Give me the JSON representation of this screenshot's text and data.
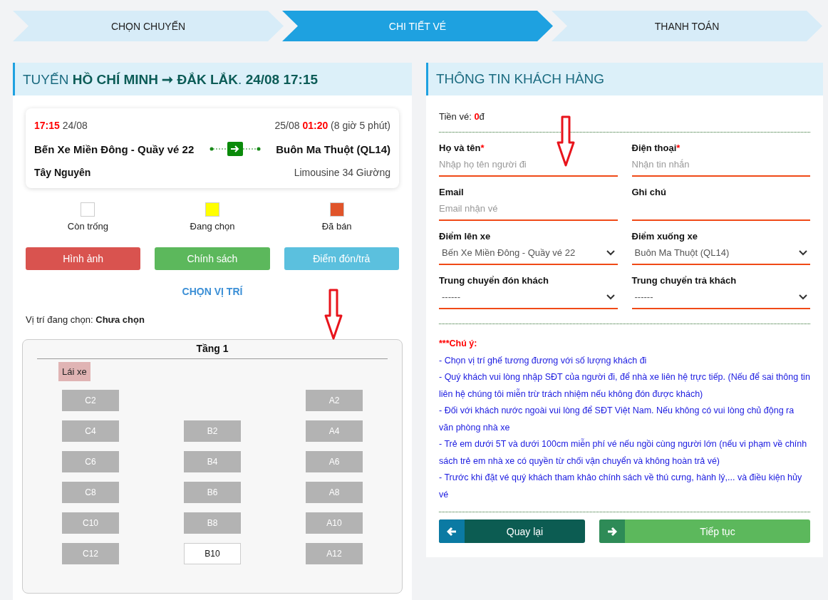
{
  "steps": [
    {
      "label": "CHỌN CHUYẾN",
      "selected": false
    },
    {
      "label": "CHI TIẾT VÉ",
      "selected": true
    },
    {
      "label": "THANH TOÁN",
      "selected": false
    }
  ],
  "route": {
    "title": "TUYẾN **HỒ CHÍ MINH ➞ ĐẮK LẮK**. **24/08 17:15**",
    "trip": {
      "depart": "**17:15** 24/08",
      "arrive": "25/08 **01:20** (8 giờ 5 phút)",
      "from": "Bến Xe Miền Đông - Quầy vé 22",
      "to": "Buôn Ma Thuột (QL14)",
      "operator": "Tây Nguyên",
      "vehicle": "Limousine 34 Giường"
    },
    "legend": [
      {
        "label": "Còn trống",
        "color": "#ffffff"
      },
      {
        "label": "Đang chọn",
        "color": "#ffff00"
      },
      {
        "label": "Đã bán",
        "color": "#e0542a"
      }
    ],
    "buttons": [
      {
        "label": "Hình ảnh",
        "kind": "danger"
      },
      {
        "label": "Chính sách",
        "kind": "success"
      },
      {
        "label": "Điểm đón/trả",
        "kind": "info"
      }
    ],
    "seat_heading": "CHỌN VỊ TRÍ",
    "current": "Vị trí đang chọn: **Chưa chọn**",
    "deck": {
      "title": "Tầng 1",
      "driver": "Lái xe",
      "rows": [
        [
          {
            "kind": "seat",
            "label": "C2",
            "available": false
          },
          {
            "kind": "gap"
          },
          {
            "kind": "seat",
            "label": "A2",
            "available": false
          }
        ],
        [
          {
            "kind": "seat",
            "label": "C4",
            "available": false
          },
          {
            "kind": "seat",
            "label": "B2",
            "available": false
          },
          {
            "kind": "seat",
            "label": "A4",
            "available": false
          }
        ],
        [
          {
            "kind": "seat",
            "label": "C6",
            "available": false
          },
          {
            "kind": "seat",
            "label": "B4",
            "available": false
          },
          {
            "kind": "seat",
            "label": "A6",
            "available": false
          }
        ],
        [
          {
            "kind": "seat",
            "label": "C8",
            "available": false
          },
          {
            "kind": "seat",
            "label": "B6",
            "available": false
          },
          {
            "kind": "seat",
            "label": "A8",
            "available": false
          }
        ],
        [
          {
            "kind": "seat",
            "label": "C10",
            "available": false
          },
          {
            "kind": "seat",
            "label": "B8",
            "available": false
          },
          {
            "kind": "seat",
            "label": "A10",
            "available": false
          }
        ],
        [
          {
            "kind": "seat",
            "label": "C12",
            "available": false
          },
          {
            "kind": "seat",
            "label": "B10",
            "available": true
          },
          {
            "kind": "seat",
            "label": "A12",
            "available": false
          }
        ]
      ]
    }
  },
  "customer": {
    "title": "THÔNG TIN KHÁCH HÀNG",
    "price": "Tiền vé: **0**đ",
    "fields": [
      {
        "label": "Họ và tên",
        "marker": "*",
        "kind": "input",
        "placeholder": "Nhập họ tên người đi"
      },
      {
        "label": "Điện thoại",
        "marker": "*",
        "kind": "input",
        "placeholder": "Nhận tin nhắn"
      },
      {
        "label": "Email",
        "kind": "input",
        "placeholder": "Email nhận vé"
      },
      {
        "label": "Ghi chú",
        "kind": "input"
      },
      {
        "label": "Điểm lên xe",
        "kind": "select",
        "value": "Bến Xe Miền Đông - Quầy vé 22"
      },
      {
        "label": "Điểm xuống xe",
        "kind": "select",
        "value": "Buôn Ma Thuột (QL14)"
      },
      {
        "label": "Trung chuyển đón khách",
        "kind": "select",
        "value": "------"
      },
      {
        "label": "Trung chuyển trả khách",
        "kind": "select",
        "value": "------"
      }
    ],
    "note_title": "***Chú ý:",
    "notes": [
      "- Chọn vị trí ghế tương đương với số lượng khách đi",
      "- Quý khách vui lòng nhập SĐT của người đi, để nhà xe liên hệ trực tiếp. (Nếu để sai thông tin liên hệ chúng tôi miễn trừ trách nhiệm nếu không đón được khách)",
      "- Đối với khách nước ngoài vui lòng để SĐT Việt Nam. Nếu không có vui lòng chủ động ra văn phòng nhà xe",
      "- Trẻ em dưới 5T và dưới 100cm miễn phí vé nếu ngồi cùng người lớn (nếu vi phạm về chính sách trẻ em nhà xe có quyền từ chối vận chuyển và không hoàn trả vé)",
      "- Trước khi đặt vé quý khách tham khảo chính sách về thú cưng, hành lý,... và điều kiện hủy vé"
    ],
    "actions": [
      {
        "label": "Quay lại",
        "kind": "back"
      },
      {
        "label": "Tiếp tục",
        "kind": "next"
      }
    ]
  }
}
